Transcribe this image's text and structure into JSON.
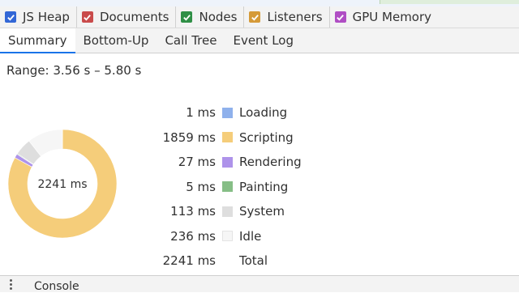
{
  "counters": [
    {
      "label": "JS Heap",
      "color": "#3367d6"
    },
    {
      "label": "Documents",
      "color": "#c94b4b"
    },
    {
      "label": "Nodes",
      "color": "#2f8f46"
    },
    {
      "label": "Listeners",
      "color": "#d59a38"
    },
    {
      "label": "GPU Memory",
      "color": "#b04ec4"
    }
  ],
  "tabs": [
    "Summary",
    "Bottom-Up",
    "Call Tree",
    "Event Log"
  ],
  "active_tab": "Summary",
  "range_text": "Range: 3.56 s – 5.80 s",
  "chart_data": {
    "type": "pie",
    "center_label": "2241 ms",
    "categories": [
      "Loading",
      "Scripting",
      "Rendering",
      "Painting",
      "System",
      "Idle"
    ],
    "values": [
      1,
      1859,
      27,
      5,
      113,
      236
    ],
    "value_labels": [
      "1 ms",
      "1859 ms",
      "27 ms",
      "5 ms",
      "113 ms",
      "236 ms"
    ],
    "colors": [
      "#8fb1ec",
      "#f5cd7a",
      "#ae93ea",
      "#86be86",
      "#dedede",
      "#f6f6f6"
    ],
    "total": {
      "label": "Total",
      "value_label": "2241 ms",
      "value": 2241
    }
  },
  "drawer": {
    "label": "Console"
  }
}
